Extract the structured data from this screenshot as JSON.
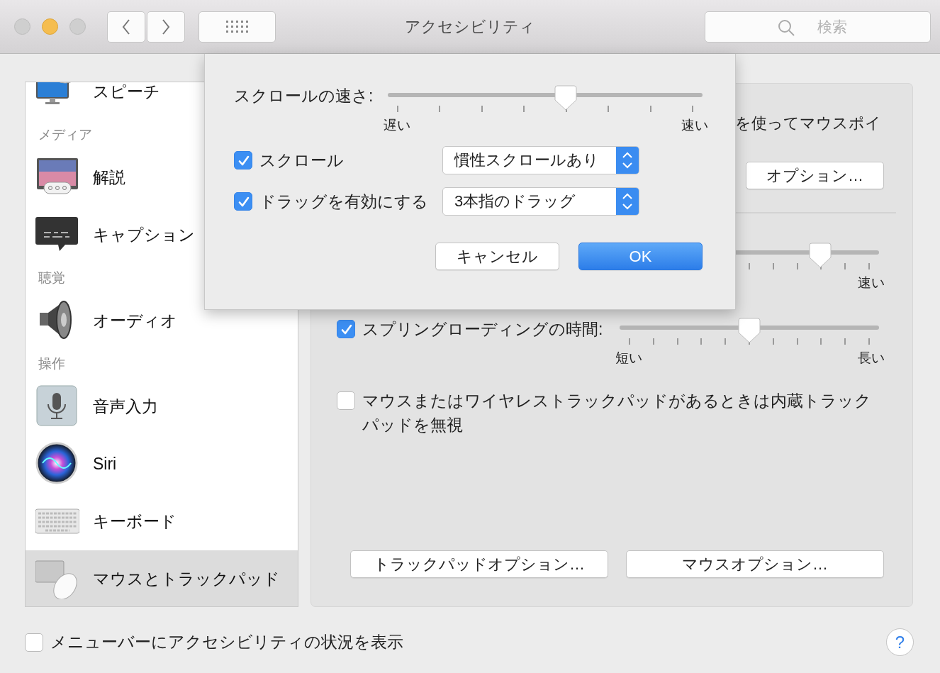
{
  "window": {
    "title": "アクセシビリティ"
  },
  "toolbar": {
    "search": {
      "placeholder": "検索"
    }
  },
  "sidebar": {
    "items": [
      {
        "kind": "item",
        "label": "スピーチ",
        "selected": false
      },
      {
        "kind": "heading",
        "label": "メディア"
      },
      {
        "kind": "item",
        "label": "解説",
        "selected": false
      },
      {
        "kind": "item",
        "label": "キャプション",
        "selected": false
      },
      {
        "kind": "heading",
        "label": "聴覚"
      },
      {
        "kind": "item",
        "label": "オーディオ",
        "selected": false
      },
      {
        "kind": "heading",
        "label": "操作"
      },
      {
        "kind": "item",
        "label": "音声入力",
        "selected": false
      },
      {
        "kind": "item",
        "label": "Siri",
        "selected": false
      },
      {
        "kind": "item",
        "label": "キーボード",
        "selected": false
      },
      {
        "kind": "item",
        "label": "マウスとトラックパッド",
        "selected": true
      }
    ]
  },
  "panel": {
    "partial_text": "を使ってマウスポイ",
    "options_button": "オプション…",
    "slider": {
      "level": 0.8,
      "max_label": "速い"
    },
    "spring_loading": {
      "checked": true,
      "label": "スプリングローディングの時間:",
      "level": 0.5,
      "min_label": "短い",
      "max_label": "長い"
    },
    "ignore_trackpad": {
      "checked": false,
      "label": "マウスまたはワイヤレストラックパッドがあるときは内蔵トラックパッドを無視"
    },
    "buttons": [
      "トラックパッドオプション…",
      "マウスオプション…"
    ]
  },
  "sheet": {
    "scroll_speed": {
      "label": "スクロールの速さ:",
      "level": 0.571,
      "min_label": "遅い",
      "max_label": "速い"
    },
    "options": [
      {
        "checked": true,
        "label": "スクロール",
        "value": "慣性スクロールあり"
      },
      {
        "checked": true,
        "label": "ドラッグを有効にする",
        "value": "3本指のドラッグ"
      }
    ],
    "buttons": [
      {
        "label": "キャンセル",
        "default": false
      },
      {
        "label": "OK",
        "default": true
      }
    ]
  },
  "footer": {
    "checked": false,
    "label": "メニューバーにアクセシビリティの状況を表示",
    "help": "?"
  }
}
